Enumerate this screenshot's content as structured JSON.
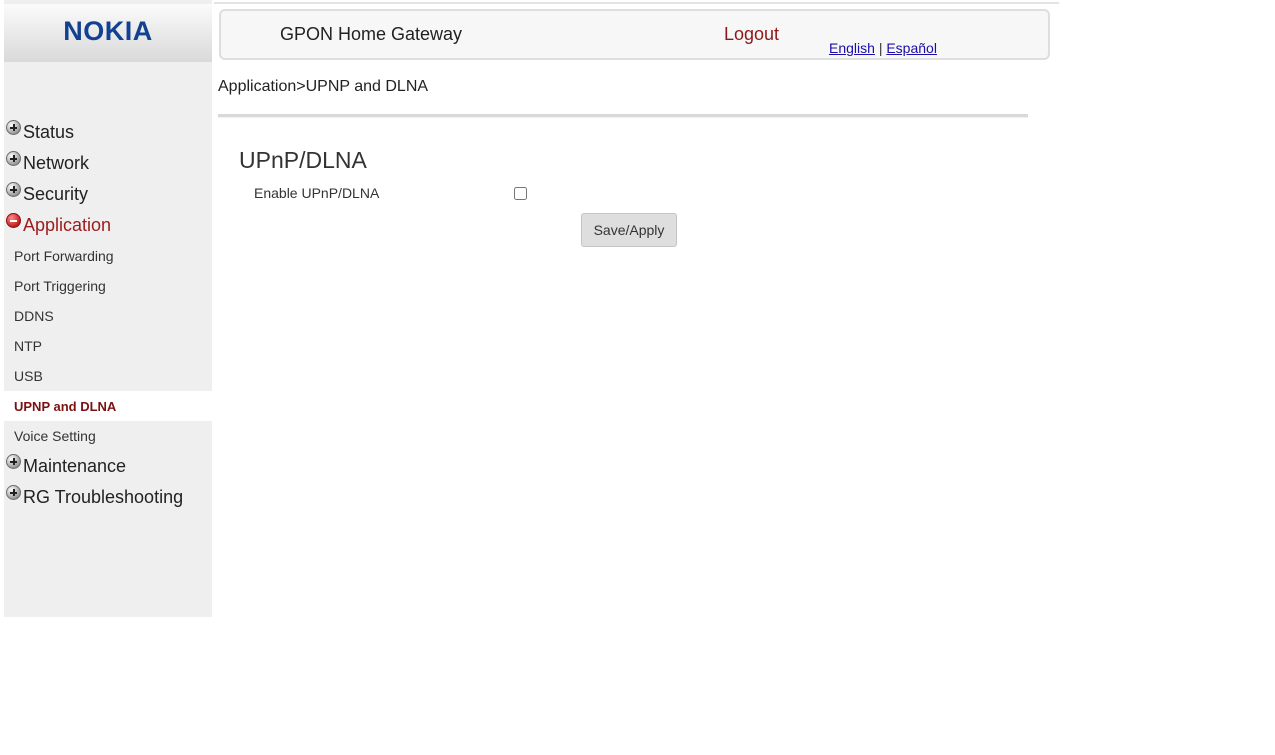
{
  "brand": {
    "logo_text": "NOKIA",
    "logo_color": "#124191"
  },
  "header": {
    "title": "GPON Home Gateway",
    "logout_label": "Logout",
    "languages": [
      "English",
      "Español"
    ],
    "language_separator": "|"
  },
  "breadcrumb": "Application>UPNP and DLNA",
  "sidebar": {
    "groups": [
      {
        "label": "Status",
        "expanded": false
      },
      {
        "label": "Network",
        "expanded": false
      },
      {
        "label": "Security",
        "expanded": false
      },
      {
        "label": "Application",
        "expanded": true,
        "items": [
          "Port Forwarding",
          "Port Triggering",
          "DDNS",
          "NTP",
          "USB",
          "UPNP and DLNA",
          "Voice Setting"
        ],
        "selected": "UPNP and DLNA"
      },
      {
        "label": "Maintenance",
        "expanded": false
      },
      {
        "label": "RG Troubleshooting",
        "expanded": false
      }
    ]
  },
  "main": {
    "section_title": "UPnP/DLNA",
    "enable_label": "Enable UPnP/DLNA",
    "enable_checked": false,
    "save_button": "Save/Apply"
  },
  "colors": {
    "active_nav": "#9a1c1c",
    "selected_item": "#7a1212",
    "logout": "#8a1a1a",
    "link": "#1a0dab"
  }
}
